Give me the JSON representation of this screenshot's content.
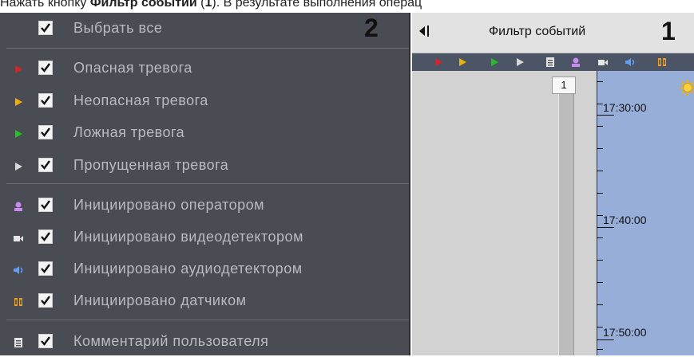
{
  "doc": {
    "prefix": "Нажать кнопку ",
    "bold": "Фильтр событий",
    "middle": " (",
    "bold_num": "1",
    "suffix": "). В результате выполнения операц"
  },
  "filter_panel": {
    "marker": "2",
    "select_all": "Выбрать все",
    "groups": [
      {
        "items": [
          {
            "label": "Опасная тревога",
            "icon": "triangle-icon",
            "color": "#e02020",
            "checked": true
          },
          {
            "label": "Неопасная тревога",
            "icon": "triangle-icon",
            "color": "#f0b000",
            "checked": true
          },
          {
            "label": "Ложная тревога",
            "icon": "triangle-icon",
            "color": "#22c022",
            "checked": true
          },
          {
            "label": "Пропущенная тревога",
            "icon": "triangle-icon",
            "color": "#d8d8d8",
            "checked": true
          }
        ]
      },
      {
        "items": [
          {
            "label": "Инициировано оператором",
            "icon": "person-icon",
            "color": "#c88bf0",
            "checked": true
          },
          {
            "label": "Инициировано видеодетектором",
            "icon": "camera-icon",
            "color": "#e6e6e6",
            "checked": true
          },
          {
            "label": "Инициировано аудиодетектором",
            "icon": "speaker-icon",
            "color": "#5aa0ff",
            "checked": true
          },
          {
            "label": "Инициировано датчиком",
            "icon": "sensor-icon",
            "color": "#f0a020",
            "checked": true
          }
        ]
      },
      {
        "items": [
          {
            "label": "Комментарий пользователя",
            "icon": "comment-icon",
            "color": "#e6e6e6",
            "checked": true
          }
        ]
      }
    ]
  },
  "timeline": {
    "marker": "1",
    "title": "Фильтр событий",
    "position_marker": "1",
    "times": [
      "17:30:00",
      "17:40:00",
      "17:50:00"
    ]
  }
}
